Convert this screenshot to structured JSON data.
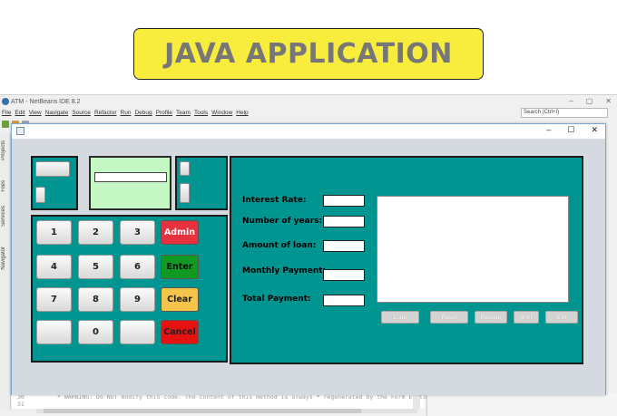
{
  "banner": {
    "title": "JAVA APPLICATION"
  },
  "ide": {
    "title": "ATM - NetBeans IDE 8.2",
    "window_controls": [
      "–",
      "▢",
      "✕"
    ],
    "menu": [
      "File",
      "Edit",
      "View",
      "Navigate",
      "Source",
      "Refactor",
      "Run",
      "Debug",
      "Profile",
      "Team",
      "Tools",
      "Window",
      "Help"
    ],
    "search_placeholder": "Search (Ctrl+I)",
    "side_tabs": [
      "Projects",
      "Files",
      "Services",
      "Navigator"
    ],
    "code_line_numbers": "30\n31",
    "code_text": "* WARNING: Do NOT modify this code. The content of this method is always\n* regenerated by the Form Editor."
  },
  "frame": {
    "window_controls": [
      "–",
      "☐",
      "✕"
    ]
  },
  "keypad": {
    "digits": [
      "1",
      "2",
      "3",
      "4",
      "5",
      "6",
      "7",
      "8",
      "9",
      "",
      "0",
      ""
    ],
    "actions": [
      "Admin",
      "Enter",
      "Clear",
      "Cancel"
    ]
  },
  "calculator": {
    "labels": [
      "Interest Rate:",
      "Number of years:",
      "Amount of loan:",
      "Monthly Payment:",
      "Total Payment:"
    ],
    "buttons": [
      "Loan",
      "Reset",
      "Receipt",
      "print",
      "Exit"
    ]
  },
  "colors": {
    "teal_panel": "#009591",
    "screen_green": "#c5f7c5",
    "admin": "#e8313e",
    "enter": "#119a22",
    "clear": "#f5c44a",
    "cancel": "#e51212",
    "banner": "#f8ec3d"
  }
}
